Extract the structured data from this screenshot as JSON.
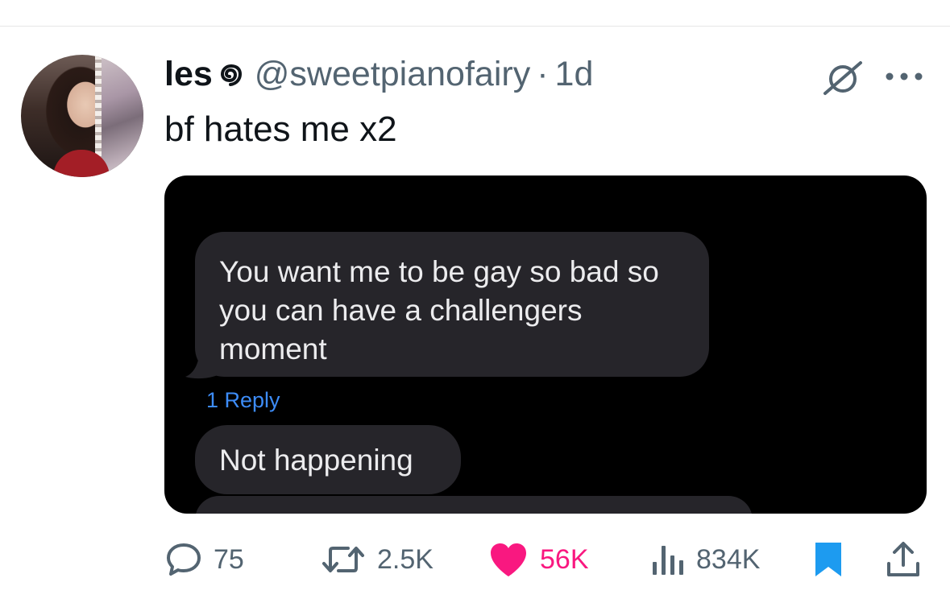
{
  "tweet": {
    "display_name": "les",
    "handle": "@sweetpianofairy",
    "separator": "·",
    "time": "1d",
    "text": "bf hates me x2"
  },
  "media": {
    "message_1_lines": [
      "You want me to be gay so bad so",
      "you can have a challengers",
      "moment"
    ],
    "reply_link": "1 Reply",
    "message_2": "Not happening"
  },
  "actions": {
    "replies": "75",
    "reposts": "2.5K",
    "likes": "56K",
    "views": "834K"
  },
  "colors": {
    "text": "#0f1419",
    "muted": "#536471",
    "like": "#f91880",
    "bookmark": "#1d9bf0",
    "bubble": "#26252a",
    "link": "#3d8cf7"
  },
  "icons": [
    "reply-icon",
    "repost-icon",
    "like-icon",
    "views-icon",
    "bookmark-icon",
    "share-icon",
    "grok-icon",
    "more-icon"
  ]
}
